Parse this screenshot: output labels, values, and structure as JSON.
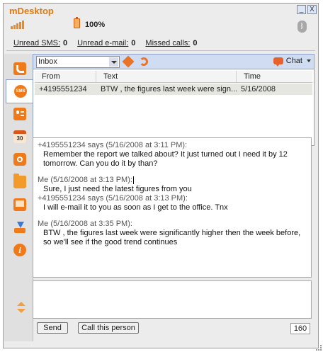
{
  "app": {
    "title": "mDesktop"
  },
  "window_controls": {
    "minimize": "_",
    "close": "X"
  },
  "status": {
    "signal_bars": 5,
    "battery_percent": "100%",
    "unread_sms_label": "Unread SMS:",
    "unread_sms": "0",
    "unread_email_label": "Unread e-mail:",
    "unread_email": "0",
    "missed_calls_label": "Missed calls:",
    "missed_calls": "0"
  },
  "sidebar": {
    "items": [
      {
        "name": "calls",
        "icon": "phone-icon"
      },
      {
        "name": "sms",
        "icon": "sms-icon",
        "label": "SMS",
        "active": true
      },
      {
        "name": "contacts",
        "icon": "contacts-icon"
      },
      {
        "name": "calendar",
        "icon": "calendar-icon",
        "label": "30"
      },
      {
        "name": "camera",
        "icon": "camera-icon"
      },
      {
        "name": "files",
        "icon": "folder-icon"
      },
      {
        "name": "screen",
        "icon": "screen-icon"
      },
      {
        "name": "install",
        "icon": "download-icon"
      },
      {
        "name": "about",
        "icon": "info-icon",
        "label": "i"
      }
    ]
  },
  "toolbar": {
    "folder_value": "Inbox",
    "chat_label": "Chat"
  },
  "list": {
    "columns": {
      "from": "From",
      "text": "Text",
      "time": "Time"
    },
    "rows": [
      {
        "from": "+4195551234",
        "text": "BTW , the figures last week were sign...",
        "time": "5/16/2008"
      }
    ]
  },
  "conversation": {
    "messages": [
      {
        "header": "+4195551234 says (5/16/2008 at 3:11 PM):",
        "body": "Remember the report we talked about? It just turned out I need it by 12 tomorrow. Can you do it by than?"
      },
      {
        "header": "Me (5/16/2008 at 3:13 PM):",
        "body": "Sure, I just need the latest figures from you"
      },
      {
        "header": "+4195551234 says (5/16/2008 at 3:13 PM):",
        "body": "I will e-mail it to you as soon as I get to the office. Tnx"
      },
      {
        "header": "Me (5/16/2008 at 3:35 PM):",
        "body": "BTW , the figures last week were significantly higher then the week before, so we'll see if the good trend continues"
      }
    ]
  },
  "compose": {
    "send_label": "Send",
    "call_label": "Call this person",
    "char_count": "160"
  },
  "colors": {
    "accent": "#f07a1a",
    "toolbar": "#cfdcf2"
  }
}
